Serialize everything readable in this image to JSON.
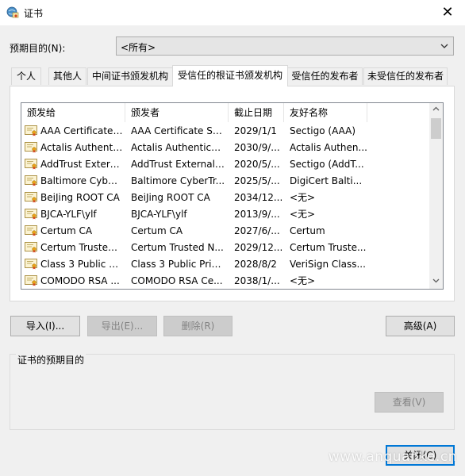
{
  "window": {
    "title": "证书",
    "close_glyph": "✕"
  },
  "purpose": {
    "label": "预期目的(N):",
    "value": "<所有>"
  },
  "tabs": [
    {
      "label": "个人"
    },
    {
      "label": "其他人"
    },
    {
      "label": "中间证书颁发机构"
    },
    {
      "label": "受信任的根证书颁发机构",
      "active": true
    },
    {
      "label": "受信任的发布者"
    },
    {
      "label": "未受信任的发布者"
    }
  ],
  "list": {
    "headers": [
      "颁发给",
      "颁发者",
      "截止日期",
      "友好名称"
    ],
    "rows": [
      [
        "AAA Certificate S...",
        "AAA Certificate Ser...",
        "2029/1/1",
        "Sectigo (AAA)"
      ],
      [
        "Actalis Authentic...",
        "Actalis Authenticati...",
        "2030/9/...",
        "Actalis Authen..."
      ],
      [
        "AddTrust Extern...",
        "AddTrust External ...",
        "2020/5/...",
        "Sectigo (AddT..."
      ],
      [
        "Baltimore Cyber...",
        "Baltimore CyberTr...",
        "2025/5/...",
        "DigiCert Balti..."
      ],
      [
        "BeiJing ROOT CA",
        "BeiJing ROOT CA",
        "2034/12...",
        "<无>"
      ],
      [
        "BJCA-YLF\\ylf",
        "BJCA-YLF\\ylf",
        "2013/9/...",
        "<无>"
      ],
      [
        "Certum CA",
        "Certum CA",
        "2027/6/...",
        "Certum"
      ],
      [
        "Certum Trusted ...",
        "Certum Trusted N...",
        "2029/12...",
        "Certum Truste..."
      ],
      [
        "Class 3 Public Pr...",
        "Class 3 Public Prim...",
        "2028/8/2",
        "VeriSign Class..."
      ],
      [
        "COMODO RSA ...",
        "COMODO RSA Ce...",
        "2038/1/...",
        "<无>"
      ]
    ]
  },
  "buttons": {
    "import": "导入(I)...",
    "export": "导出(E)...",
    "remove": "删除(R)",
    "advanced": "高级(A)",
    "view": "查看(V)",
    "close": "关闭(C)"
  },
  "group": {
    "title": "证书的预期目的"
  },
  "watermark": "www.anquanke.cn",
  "colors": {
    "accent": "#0078d7",
    "certificate_ribbon": "#e8a317"
  }
}
